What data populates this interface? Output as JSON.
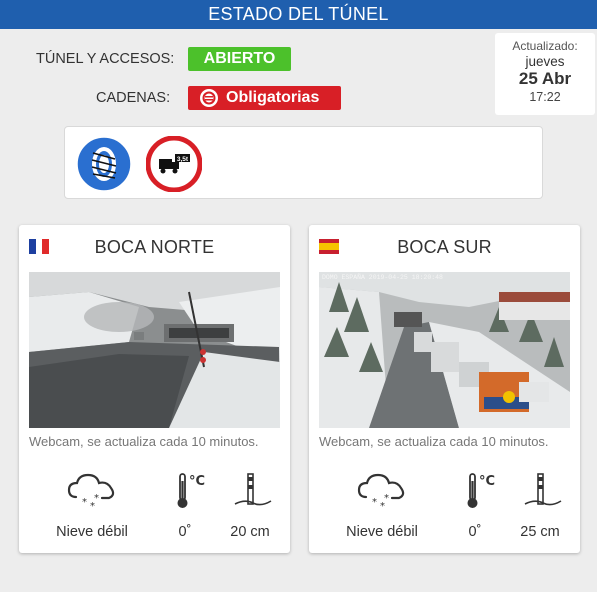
{
  "header": {
    "title": "ESTADO DEL TÚNEL"
  },
  "status": {
    "tunnel_label": "TÚNEL Y ACCESOS:",
    "tunnel_value": "ABIERTO",
    "chains_label": "CADENAS:",
    "chains_value": "Obligatorias"
  },
  "updated": {
    "label": "Actualizado:",
    "day": "jueves",
    "date": "25 Abr",
    "time": "17:22"
  },
  "signs": [
    "snow-chains-required-icon",
    "no-trucks-over-3.5t-icon"
  ],
  "cards": [
    {
      "title": "BOCA NORTE",
      "flag": "france",
      "cam_overlay": "",
      "caption": "Webcam, se actualiza cada 10 minutos.",
      "weather": "Nieve débil",
      "temperature": "0˚",
      "snow_depth": "20 cm"
    },
    {
      "title": "BOCA SUR",
      "flag": "spain",
      "cam_overlay": "DOMO ESPAÑA  2019-04-25 18:20:48",
      "caption": "Webcam, se actualiza cada 10 minutos.",
      "weather": "Nieve débil",
      "temperature": "0˚",
      "snow_depth": "25 cm"
    }
  ],
  "colors": {
    "header_bg": "#1f5fae",
    "open_badge": "#4cc12b",
    "required_badge": "#d81f26"
  }
}
